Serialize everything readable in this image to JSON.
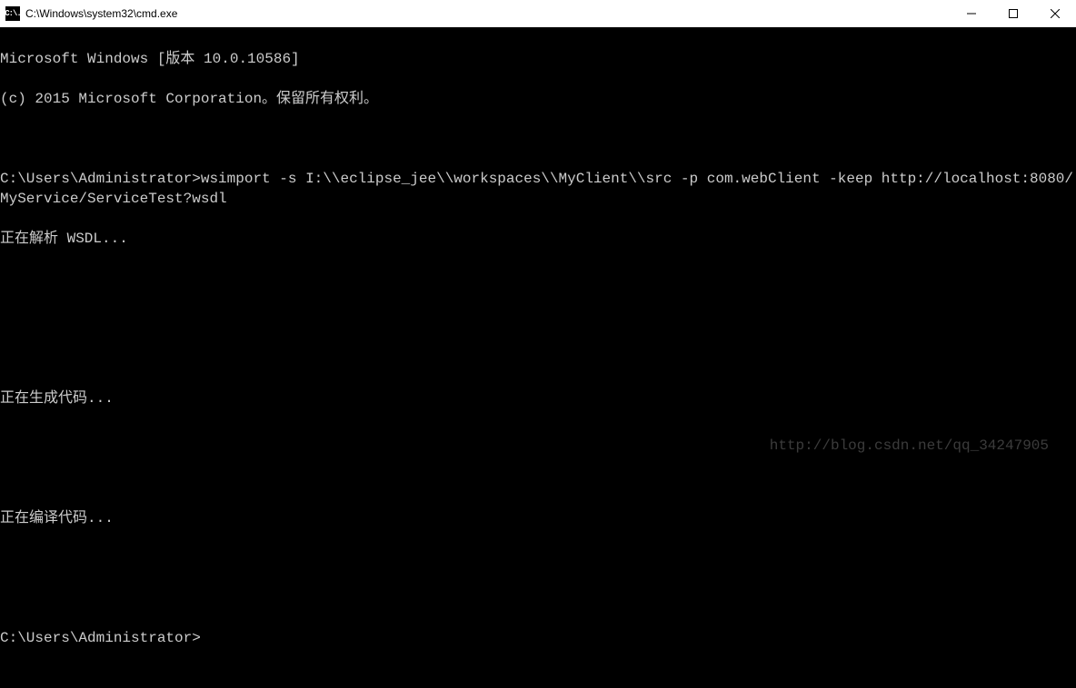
{
  "titlebar": {
    "icon_text": "C:\\.",
    "title": "C:\\Windows\\system32\\cmd.exe"
  },
  "terminal": {
    "line1": "Microsoft Windows [版本 10.0.10586]",
    "line2": "(c) 2015 Microsoft Corporation。保留所有权利。",
    "prompt1": "C:\\Users\\Administrator>",
    "command": "wsimport -s I:\\\\eclipse_jee\\\\workspaces\\\\MyClient\\\\src -p com.webClient -keep http://localhost:8080/MyService/ServiceTest?wsdl",
    "status1": "正在解析 WSDL...",
    "status2": "正在生成代码...",
    "status3": "正在编译代码...",
    "prompt2": "C:\\Users\\Administrator>"
  },
  "watermark": "http://blog.csdn.net/qq_34247905"
}
